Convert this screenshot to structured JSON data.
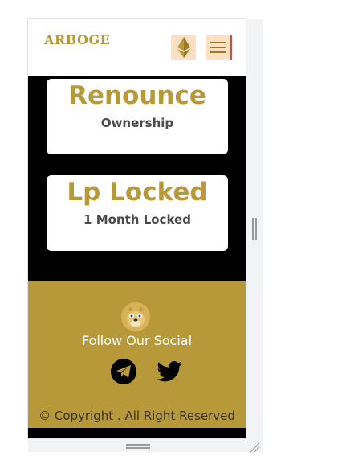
{
  "header": {
    "logo": "ARBOGE",
    "eth_icon": "ethereum-icon",
    "menu_icon": "hamburger-icon"
  },
  "cards": [
    {
      "title": "Renounce",
      "subtitle": "Ownership"
    },
    {
      "title": "Lp Locked",
      "subtitle": "1 Month Locked"
    }
  ],
  "footer": {
    "avatar_icon": "doge-avatar",
    "follow_text": "Follow Our Social",
    "social": [
      "telegram-icon",
      "twitter-icon"
    ],
    "copyright": "© Copyright . All Right Reserved"
  },
  "colors": {
    "brand_gold": "#b8993a",
    "button_bg": "#fde0c3",
    "background": "#000000"
  }
}
